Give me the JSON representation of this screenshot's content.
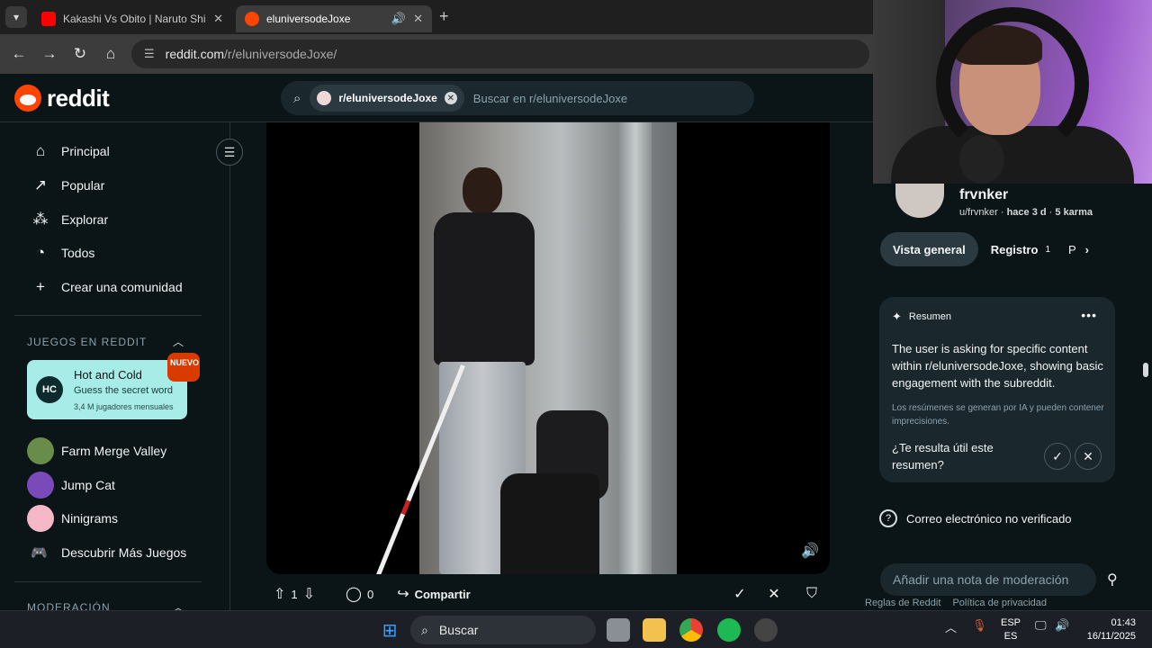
{
  "browser": {
    "tabs": [
      {
        "title": "Kakashi Vs Obito | Naruto Shipp",
        "favicon_color": "#ff0000"
      },
      {
        "title": "eluniversodeJoxe",
        "favicon_color": "#ff4500"
      }
    ],
    "url": "reddit.com",
    "url_path": "/r/eluniversodeJoxe/"
  },
  "header": {
    "logo_text": "reddit",
    "search_chip": "r/eluniversodeJoxe",
    "search_placeholder": "Buscar en r/eluniversodeJoxe"
  },
  "sidebar": {
    "nav": [
      {
        "label": "Principal",
        "icon": "home-icon"
      },
      {
        "label": "Popular",
        "icon": "popular-icon"
      },
      {
        "label": "Explorar",
        "icon": "explore-icon"
      },
      {
        "label": "Todos",
        "icon": "all-icon"
      },
      {
        "label": "Crear una comunidad",
        "icon": "plus-icon"
      }
    ],
    "games_heading": "JUEGOS EN REDDIT",
    "featured_game": {
      "title": "Hot and Cold",
      "subtitle": "Guess the secret word",
      "players": "3,4 M jugadores mensuales",
      "badge": "NUEVO"
    },
    "games": [
      {
        "label": "Farm Merge Valley",
        "color": "#6a8c4a"
      },
      {
        "label": "Jump Cat",
        "color": "#7a4ab8"
      },
      {
        "label": "Ninigrams",
        "color": "#f4b8c8"
      },
      {
        "label": "Descubrir Más Juegos",
        "color": ""
      }
    ],
    "moderation_heading": "MODERACIÓN"
  },
  "post": {
    "votes": "1",
    "comments": "0",
    "share_label": "Compartir"
  },
  "profile": {
    "display_name": "frvnker",
    "username": "u/frvnker",
    "age": "hace 3 d",
    "karma": "5 karma",
    "tabs": [
      {
        "label": "Vista general",
        "count": ""
      },
      {
        "label": "Registro",
        "count": "1"
      },
      {
        "label": "P",
        "count": ""
      }
    ]
  },
  "summary": {
    "title": "Resumen",
    "body": "The user is asking for specific content within r/eluniversodeJoxe, showing basic engagement with the subreddit.",
    "note": "Los resúmenes se generan por IA y pueden contener imprecisiones.",
    "question": "¿Te resulta útil este resumen?"
  },
  "email_status": "Correo electrónico no verificado",
  "mod_note_placeholder": "Añadir una nota de moderación",
  "footer": {
    "rules": "Reglas de Reddit",
    "privacy": "Política de privacidad"
  },
  "taskbar": {
    "search": "Buscar",
    "lang1": "ESP",
    "lang2": "ES",
    "time": "01:43",
    "date": "16/11/2025"
  },
  "colors": {
    "reddit_orange": "#ff4500",
    "bg": "#0b1416",
    "card": "#1a282d"
  }
}
